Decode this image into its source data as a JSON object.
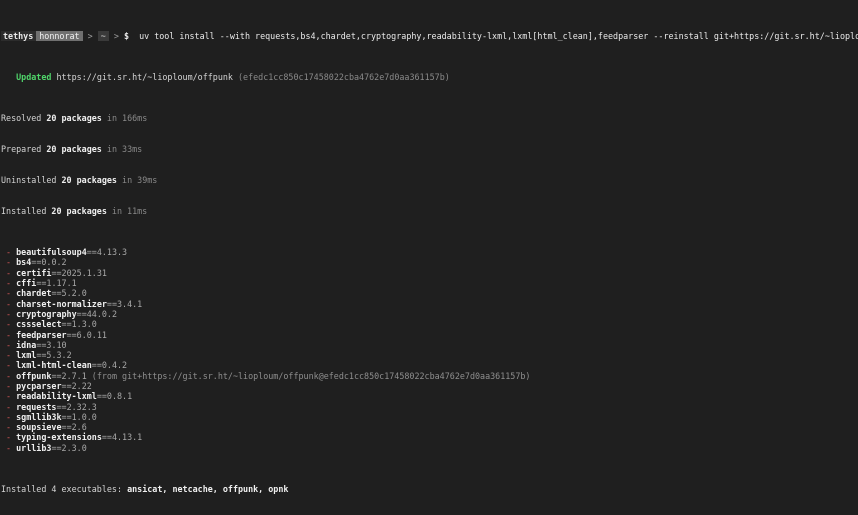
{
  "prompt": {
    "host": "tethys",
    "user": "honnorat",
    "path": "~",
    "symbol": "$",
    "command": "uv tool install --with requests,bs4,chardet,cryptography,readability-lxml,lxml[html_clean],feedparser --reinstall git+https://git.sr.ht/~lioploum/offpunk"
  },
  "updated": {
    "label": "Updated",
    "url": "https://git.sr.ht/~lioploum/offpunk",
    "hash": "(efedc1cc850c17458022cba4762e7d0aa361157b)"
  },
  "summary": [
    {
      "prefix": "Resolved ",
      "count": "20 packages",
      "suffix": " in 166ms"
    },
    {
      "prefix": "Prepared ",
      "count": "20 packages",
      "suffix": " in 33ms"
    },
    {
      "prefix": "Uninstalled ",
      "count": "20 packages",
      "suffix": " in 39ms"
    },
    {
      "prefix": "Installed ",
      "count": "20 packages",
      "suffix": " in 11ms"
    }
  ],
  "packages": [
    {
      "marker": " - ",
      "name": "beautifulsoup4",
      "version": "==4.13.3",
      "note": ""
    },
    {
      "marker": " - ",
      "name": "bs4",
      "version": "==0.0.2",
      "note": ""
    },
    {
      "marker": " - ",
      "name": "certifi",
      "version": "==2025.1.31",
      "note": ""
    },
    {
      "marker": " - ",
      "name": "cffi",
      "version": "==1.17.1",
      "note": ""
    },
    {
      "marker": " - ",
      "name": "chardet",
      "version": "==5.2.0",
      "note": ""
    },
    {
      "marker": " - ",
      "name": "charset-normalizer",
      "version": "==3.4.1",
      "note": ""
    },
    {
      "marker": " - ",
      "name": "cryptography",
      "version": "==44.0.2",
      "note": ""
    },
    {
      "marker": " - ",
      "name": "cssselect",
      "version": "==1.3.0",
      "note": ""
    },
    {
      "marker": " - ",
      "name": "feedparser",
      "version": "==6.0.11",
      "note": ""
    },
    {
      "marker": " - ",
      "name": "idna",
      "version": "==3.10",
      "note": ""
    },
    {
      "marker": " - ",
      "name": "lxml",
      "version": "==5.3.2",
      "note": ""
    },
    {
      "marker": " - ",
      "name": "lxml-html-clean",
      "version": "==0.4.2",
      "note": ""
    },
    {
      "marker": " - ",
      "name": "offpunk",
      "version": "==2.7.1",
      "note": " (from git+https://git.sr.ht/~lioploum/offpunk@efedc1cc850c17458022cba4762e7d0aa361157b)"
    },
    {
      "marker": " - ",
      "name": "pycparser",
      "version": "==2.22",
      "note": ""
    },
    {
      "marker": " - ",
      "name": "readability-lxml",
      "version": "==0.8.1",
      "note": ""
    },
    {
      "marker": " - ",
      "name": "requests",
      "version": "==2.32.3",
      "note": ""
    },
    {
      "marker": " - ",
      "name": "sgmllib3k",
      "version": "==1.0.0",
      "note": ""
    },
    {
      "marker": " - ",
      "name": "soupsieve",
      "version": "==2.6",
      "note": ""
    },
    {
      "marker": " - ",
      "name": "typing-extensions",
      "version": "==4.13.1",
      "note": ""
    },
    {
      "marker": " - ",
      "name": "urllib3",
      "version": "==2.3.0",
      "note": ""
    }
  ],
  "executables": {
    "prefix": "Installed 4 executables: ",
    "list": "ansicat, netcache, offpunk, opnk"
  },
  "colors": {
    "background": "#1f1f1f",
    "updated": "#4fd46a",
    "marker": "#e05a5a"
  }
}
